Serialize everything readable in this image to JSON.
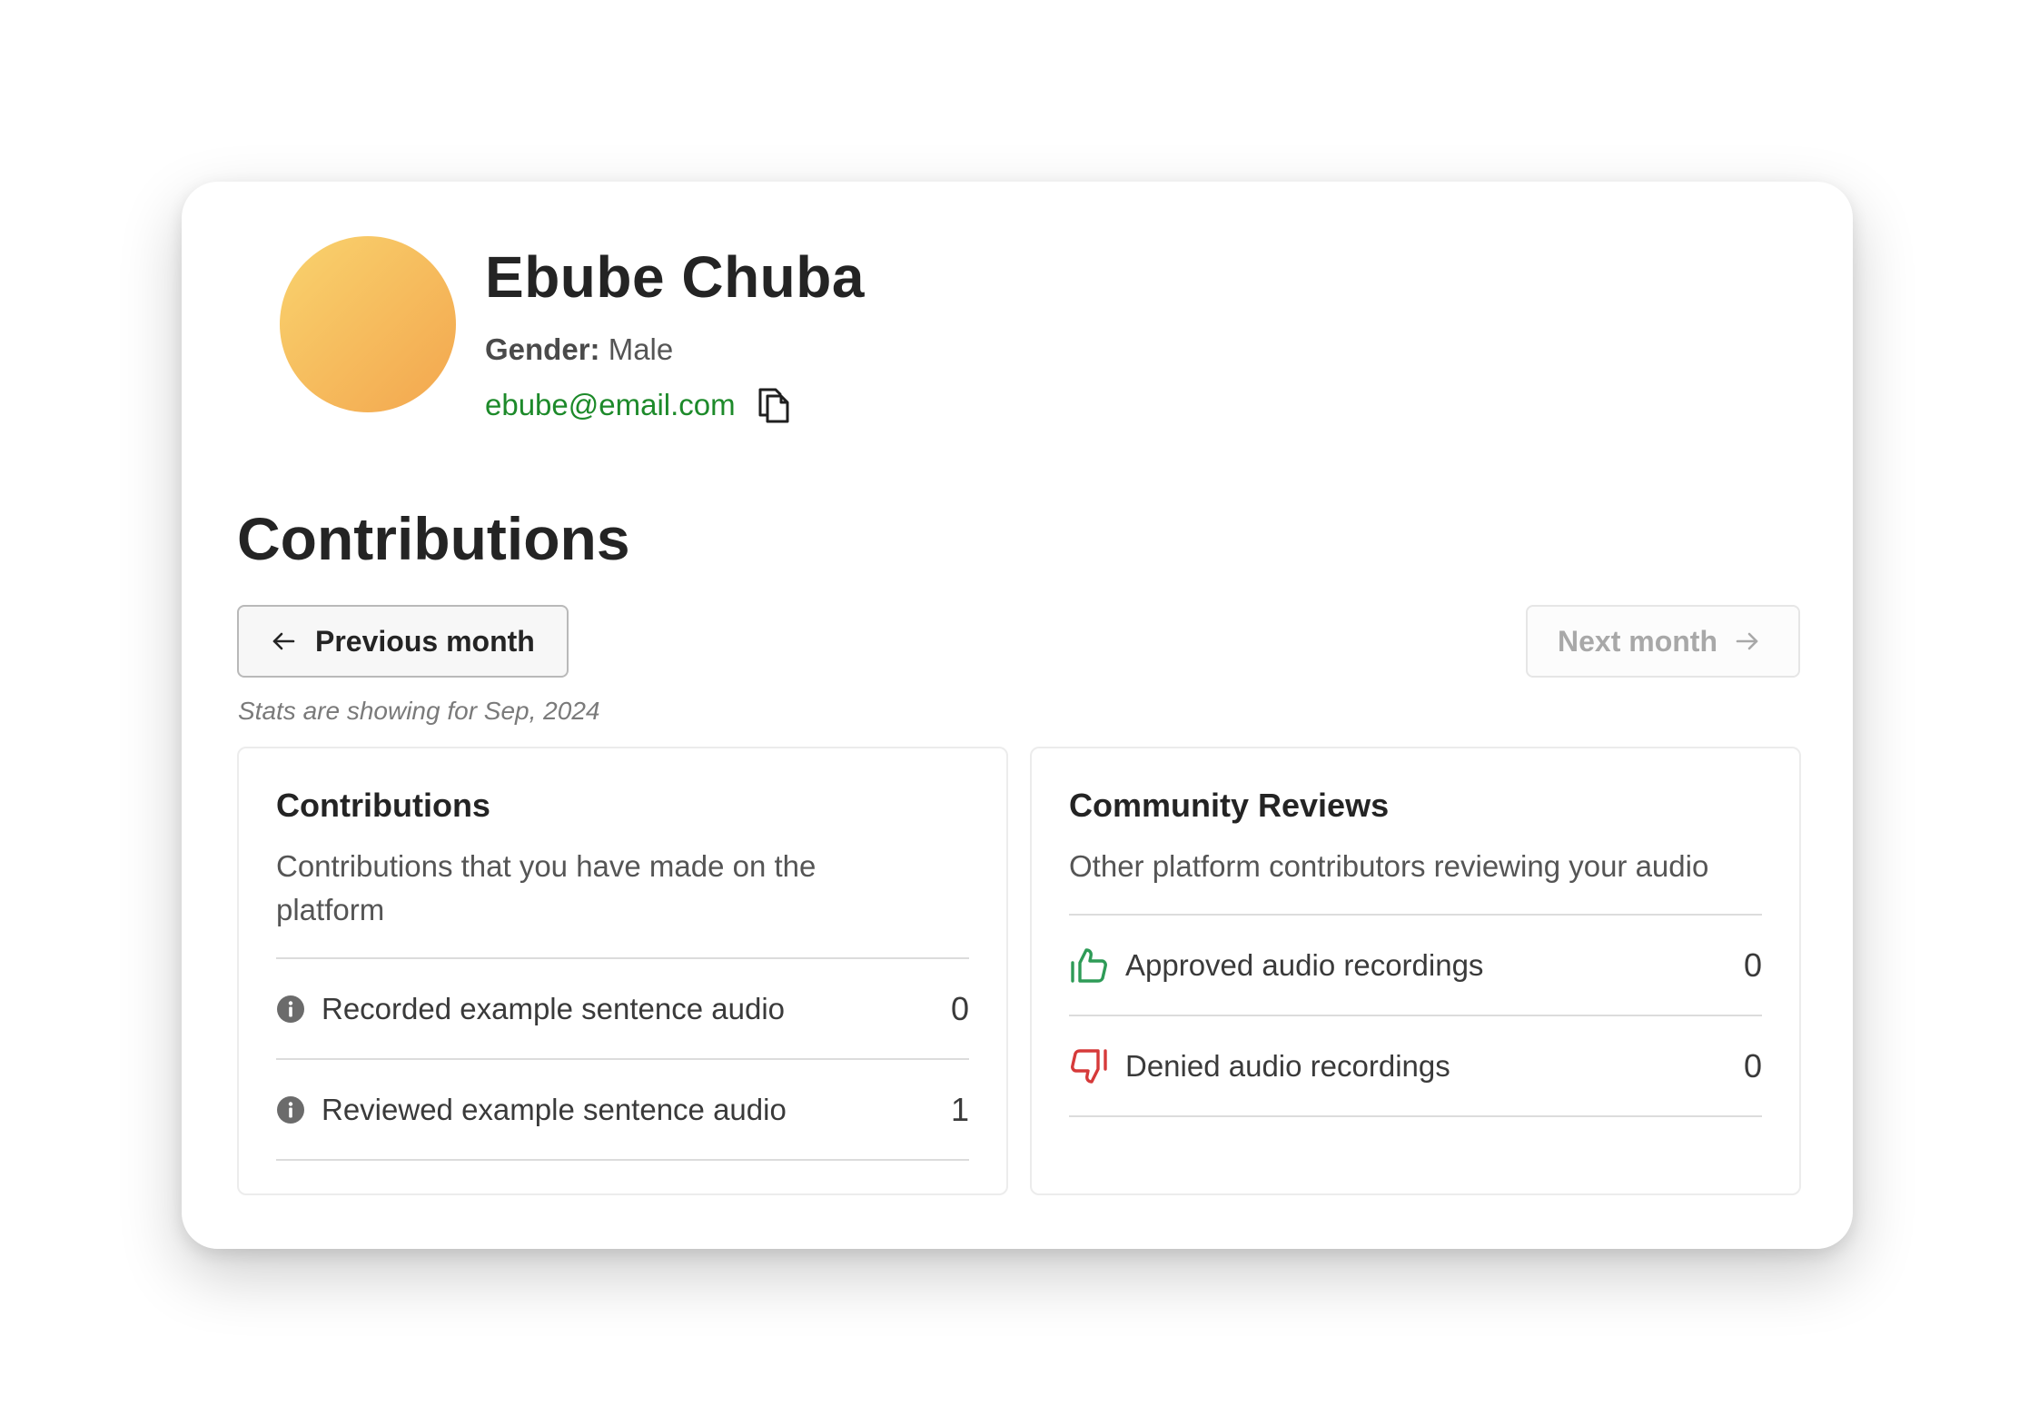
{
  "profile": {
    "name": "Ebube Chuba",
    "gender_label": "Gender:",
    "gender_value": "Male",
    "email": "ebube@email.com",
    "avatar_gradient": [
      "#f9d36e",
      "#f3a64e"
    ]
  },
  "contributions": {
    "title": "Contributions",
    "prev_label": "Previous month",
    "next_label": "Next month",
    "next_disabled": true,
    "stats_note": "Stats are showing for Sep, 2024"
  },
  "panels": {
    "contributions": {
      "title": "Contributions",
      "description": "Contributions that you have made on the platform",
      "rows": [
        {
          "icon": "info-icon",
          "label": "Recorded example sentence audio",
          "value": "0"
        },
        {
          "icon": "info-icon",
          "label": "Reviewed example sentence audio",
          "value": "1"
        }
      ]
    },
    "community_reviews": {
      "title": "Community Reviews",
      "description": "Other platform contributors reviewing your audio",
      "rows": [
        {
          "icon": "thumbs-up-icon",
          "label": "Approved audio recordings",
          "value": "0"
        },
        {
          "icon": "thumbs-down-icon",
          "label": "Denied audio recordings",
          "value": "0"
        }
      ]
    }
  },
  "colors": {
    "email": "#1d8a2a",
    "approve": "#2e9b57",
    "deny": "#d63a3a"
  }
}
